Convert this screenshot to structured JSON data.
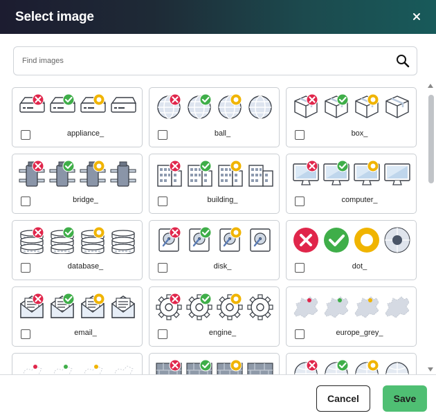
{
  "dialog": {
    "title": "Select image",
    "close_icon": "close-icon"
  },
  "search": {
    "placeholder": "Find images",
    "value": "",
    "icon": "search-icon"
  },
  "images": [
    {
      "name": "appliance_",
      "icon": "appliance",
      "checked": false
    },
    {
      "name": "ball_",
      "icon": "ball",
      "checked": false
    },
    {
      "name": "box_",
      "icon": "box",
      "checked": false
    },
    {
      "name": "bridge_",
      "icon": "bridge",
      "checked": false
    },
    {
      "name": "building_",
      "icon": "building",
      "checked": false
    },
    {
      "name": "computer_",
      "icon": "computer",
      "checked": false
    },
    {
      "name": "database_",
      "icon": "database",
      "checked": false
    },
    {
      "name": "disk_",
      "icon": "disk",
      "checked": false
    },
    {
      "name": "dot_",
      "icon": "dot",
      "checked": false
    },
    {
      "name": "email_",
      "icon": "email",
      "checked": false
    },
    {
      "name": "engine_",
      "icon": "engine",
      "checked": false
    },
    {
      "name": "europe_grey_",
      "icon": "europe",
      "checked": false
    },
    {
      "name": "",
      "icon": "map-sketch",
      "checked": false
    },
    {
      "name": "",
      "icon": "firewall",
      "checked": false
    },
    {
      "name": "",
      "icon": "globe",
      "checked": false
    }
  ],
  "variants": [
    "error",
    "ok",
    "warning",
    "plain"
  ],
  "colors": {
    "error": "#e0264b",
    "ok": "#3fae49",
    "warning": "#f0b400",
    "save_button": "#4fbf73",
    "header_start": "#1c1c30",
    "header_end": "#185a5a"
  },
  "footer": {
    "cancel_label": "Cancel",
    "save_label": "Save"
  }
}
